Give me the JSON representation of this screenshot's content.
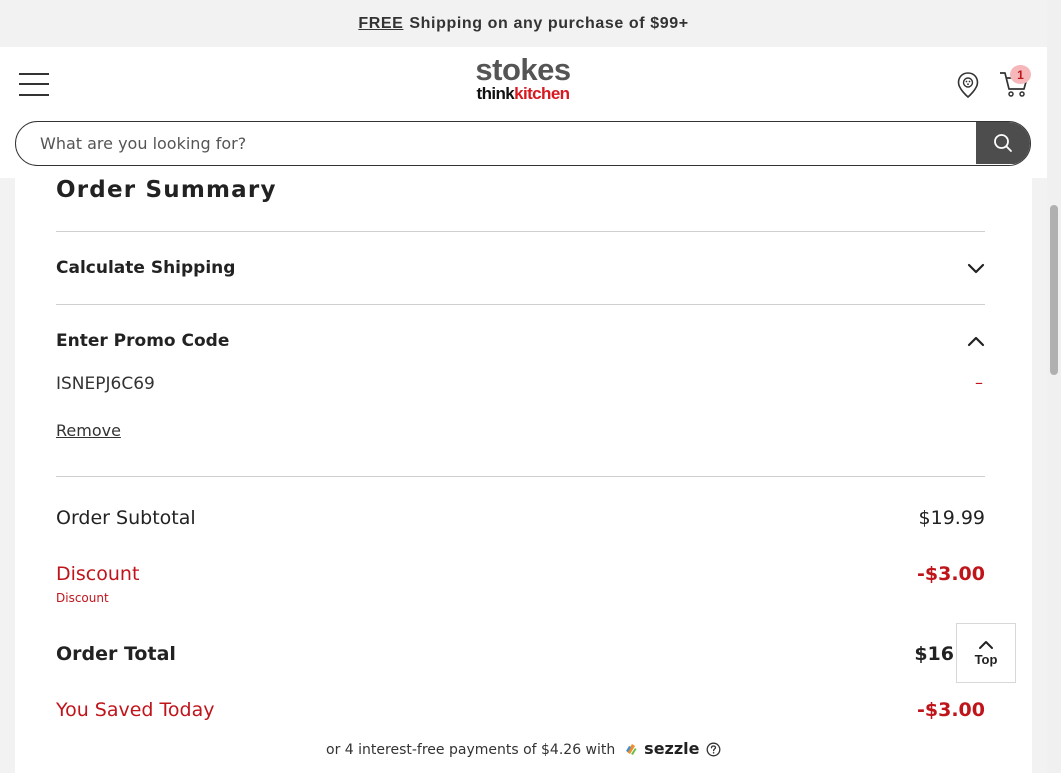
{
  "promo_bar": {
    "free": "FREE",
    "text": "Shipping on any purchase of $99+"
  },
  "header": {
    "logo_top": "stokes",
    "logo_think": "think",
    "logo_kitchen": "kitchen",
    "cart_count": "1",
    "icons": [
      "hamburger-menu-icon",
      "location-pin-icon",
      "cart-icon",
      "search-icon"
    ]
  },
  "search": {
    "placeholder": "What are you looking for?",
    "value": ""
  },
  "summary": {
    "title": "Order Summary",
    "calculate_shipping": "Calculate Shipping",
    "promo_heading": "Enter Promo Code",
    "promo_code": "ISNEPJ6C69",
    "promo_dash": "–",
    "remove": "Remove",
    "subtotal_label": "Order Subtotal",
    "subtotal_value": "$19.99",
    "discount_label": "Discount",
    "discount_sub": "Discount",
    "discount_value": "-$3.00",
    "total_label": "Order Total",
    "total_value": "$16",
    "saved_label": "You Saved Today",
    "saved_value": "-$3.00"
  },
  "sezzle": {
    "text": "or 4 interest-free payments of $4.26 with",
    "brand": "sezzle"
  },
  "top_button": {
    "label": "Top"
  },
  "colors": {
    "accent_red": "#c0141b",
    "search_button": "#4d4d4d",
    "badge": "#f5b7b9"
  }
}
